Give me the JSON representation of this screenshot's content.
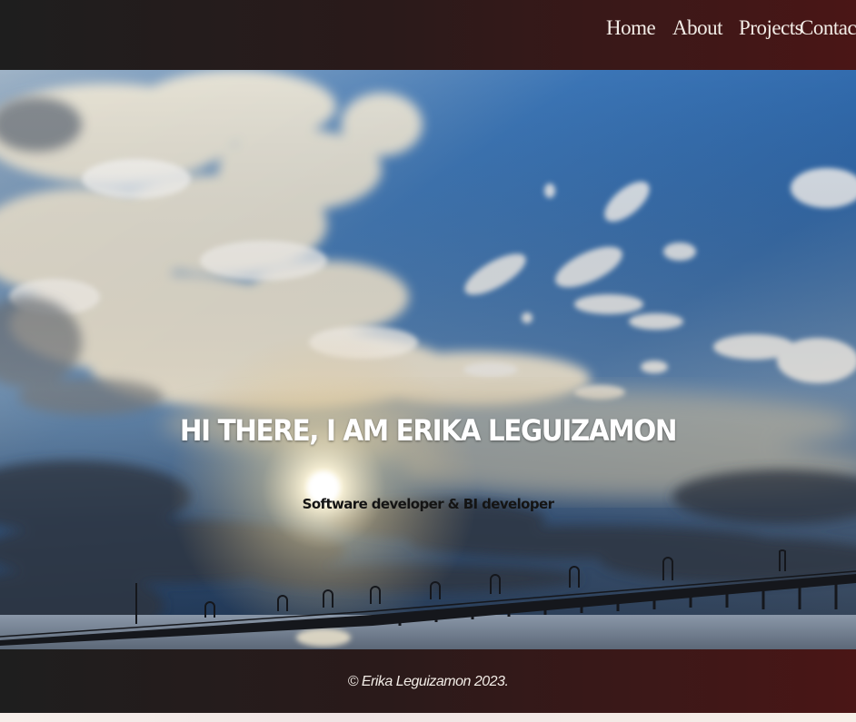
{
  "nav": {
    "home": "Home",
    "about": "About",
    "projects": "Projects",
    "contact": "Contact"
  },
  "hero": {
    "title": "HI THERE, I AM ERIKA LEGUIZAMON",
    "subtitle": "Software developer & BI developer"
  },
  "footer": {
    "copyright": "© Erika Leguizamon 2023."
  },
  "colors": {
    "header_dark": "#1e1e1e",
    "header_maroon": "#4a1616",
    "nav_text": "#f2ece6",
    "sky_blue": "#2f6bb0",
    "hero_title": "#ffffff",
    "hero_subtitle": "#141414"
  }
}
